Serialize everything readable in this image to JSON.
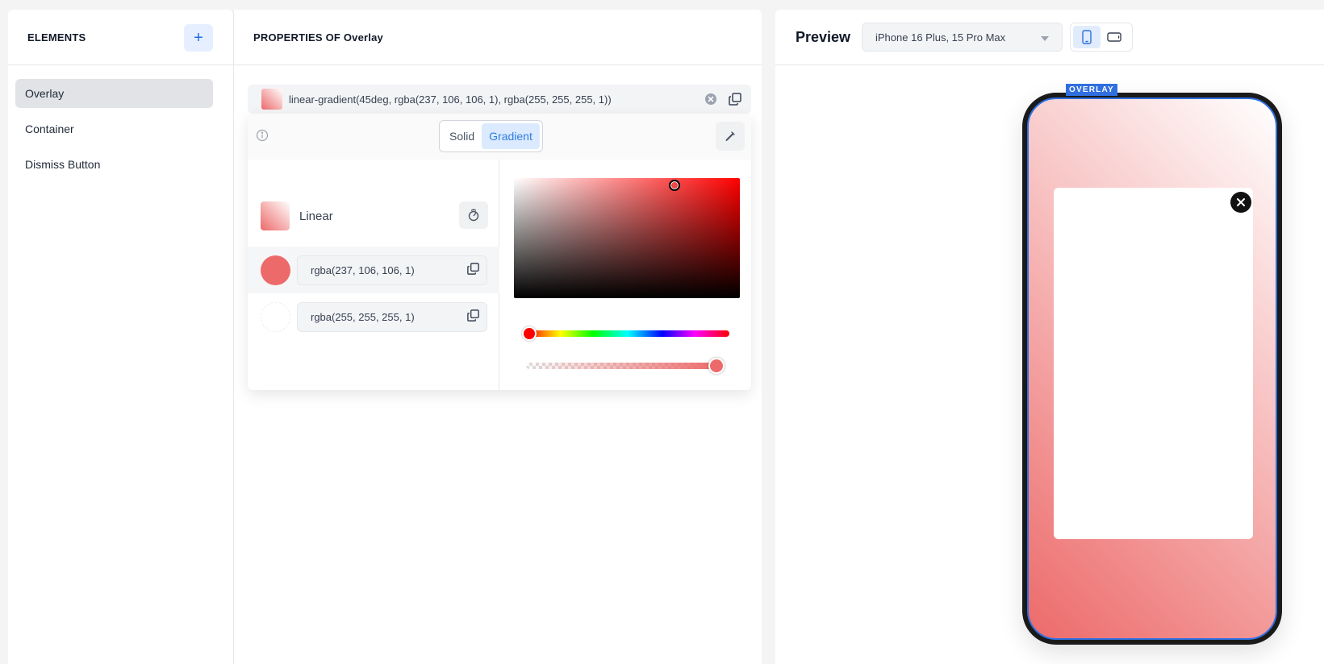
{
  "elements_panel": {
    "title": "ELEMENTS",
    "add_label": "+",
    "items": [
      {
        "label": "Overlay",
        "active": true
      },
      {
        "label": "Container",
        "active": false
      },
      {
        "label": "Dismiss Button",
        "active": false
      }
    ]
  },
  "properties_panel": {
    "title": "PROPERTIES OF Overlay",
    "color_value": "linear-gradient(45deg, rgba(237, 106, 106, 1), rgba(255, 255, 255, 1))",
    "picker": {
      "modes": [
        {
          "label": "Solid",
          "active": false
        },
        {
          "label": "Gradient",
          "active": true
        }
      ],
      "gradient_type": "Linear",
      "stops": [
        {
          "color": "rgba(237, 106, 106, 1)",
          "active": true
        },
        {
          "color": "rgba(255, 255, 255, 1)",
          "active": false
        }
      ],
      "hue": 0,
      "alpha": 1
    }
  },
  "preview_panel": {
    "title": "Preview",
    "device": "iPhone 16 Plus, 15 Pro Max",
    "orientation": "portrait",
    "overlay_tag": "OVERLAY"
  },
  "colors": {
    "accent": "#2f6fe0",
    "stop_start": "#ed6a6a",
    "stop_end": "#ffffff"
  }
}
